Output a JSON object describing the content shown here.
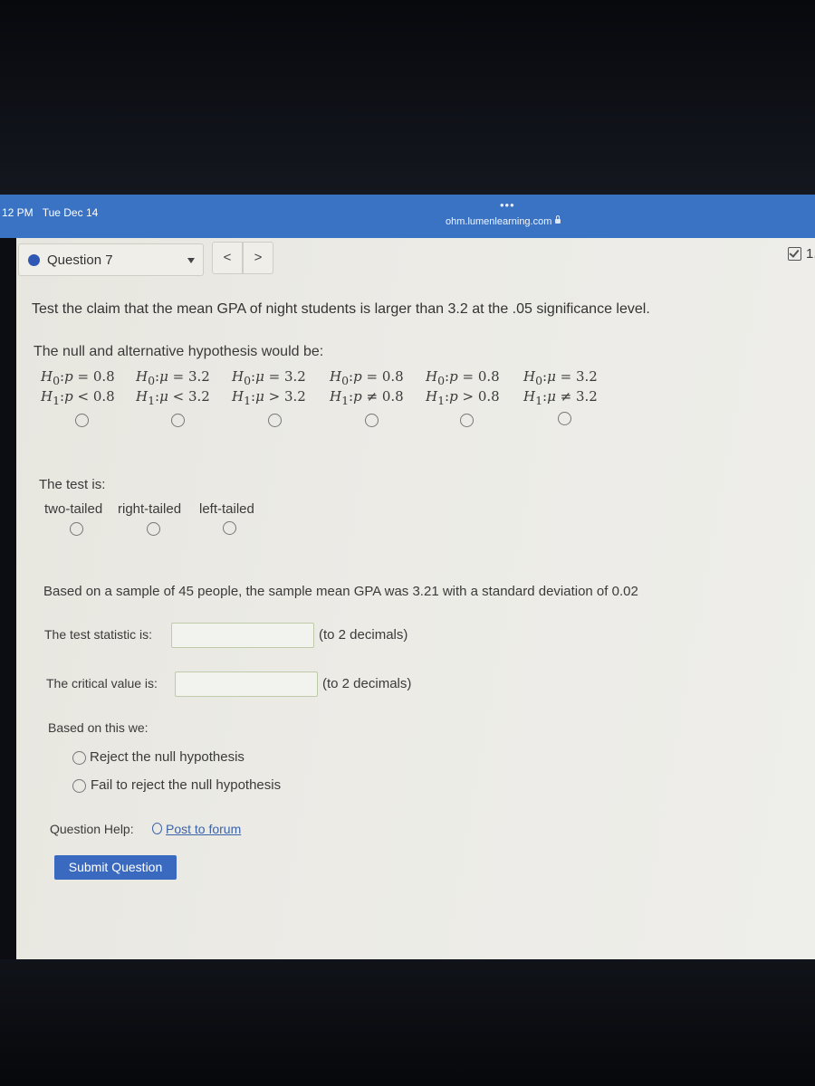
{
  "status_bar": {
    "time": "12 PM",
    "date": "Tue Dec 14",
    "dots": "•••",
    "url": "ohm.lumenlearning.com"
  },
  "question_nav": {
    "label": "Question 7",
    "prev": "<",
    "next": ">",
    "score": "1."
  },
  "question": {
    "prompt": "Test the claim that the mean GPA of night students is larger than 3.2 at the .05 significance level.",
    "hypothesis_label": "The null and alternative hypothesis would be:",
    "hypothesis_options": [
      {
        "h0_var": "p",
        "h0_op": " = ",
        "h0_val": "0.8",
        "h1_var": "p",
        "h1_op": " < ",
        "h1_val": "0.8"
      },
      {
        "h0_var": "μ",
        "h0_op": " = ",
        "h0_val": "3.2",
        "h1_var": "μ",
        "h1_op": " < ",
        "h1_val": "3.2"
      },
      {
        "h0_var": "μ",
        "h0_op": " = ",
        "h0_val": "3.2",
        "h1_var": "μ",
        "h1_op": " > ",
        "h1_val": "3.2"
      },
      {
        "h0_var": "p",
        "h0_op": " = ",
        "h0_val": "0.8",
        "h1_var": "p",
        "h1_op": " ≠ ",
        "h1_val": "0.8"
      },
      {
        "h0_var": "p",
        "h0_op": " = ",
        "h0_val": "0.8",
        "h1_var": "p",
        "h1_op": " > ",
        "h1_val": "0.8"
      },
      {
        "h0_var": "μ",
        "h0_op": " = ",
        "h0_val": "3.2",
        "h1_var": "μ",
        "h1_op": " ≠ ",
        "h1_val": "3.2"
      }
    ],
    "test_label": "The test is:",
    "tail_options": [
      "two-tailed",
      "right-tailed",
      "left-tailed"
    ],
    "sample_text": "Based on a sample of 45 people, the sample mean GPA was 3.21 with a standard deviation of 0.02",
    "test_statistic_label": "The test statistic is:",
    "test_statistic_value": "",
    "test_statistic_note": "(to 2 decimals)",
    "critical_value_label": "The critical value is:",
    "critical_value_value": "",
    "critical_value_note": "(to 2 decimals)",
    "decision_label": "Based on this we:",
    "decision_options": [
      "Reject the null hypothesis",
      "Fail to reject the null hypothesis"
    ],
    "help_label": "Question Help:",
    "forum_link": "Post to forum",
    "submit_label": "Submit Question"
  },
  "colors": {
    "accent": "#3a73c4",
    "submit": "#3a6ac0",
    "link": "#3b63a8"
  }
}
